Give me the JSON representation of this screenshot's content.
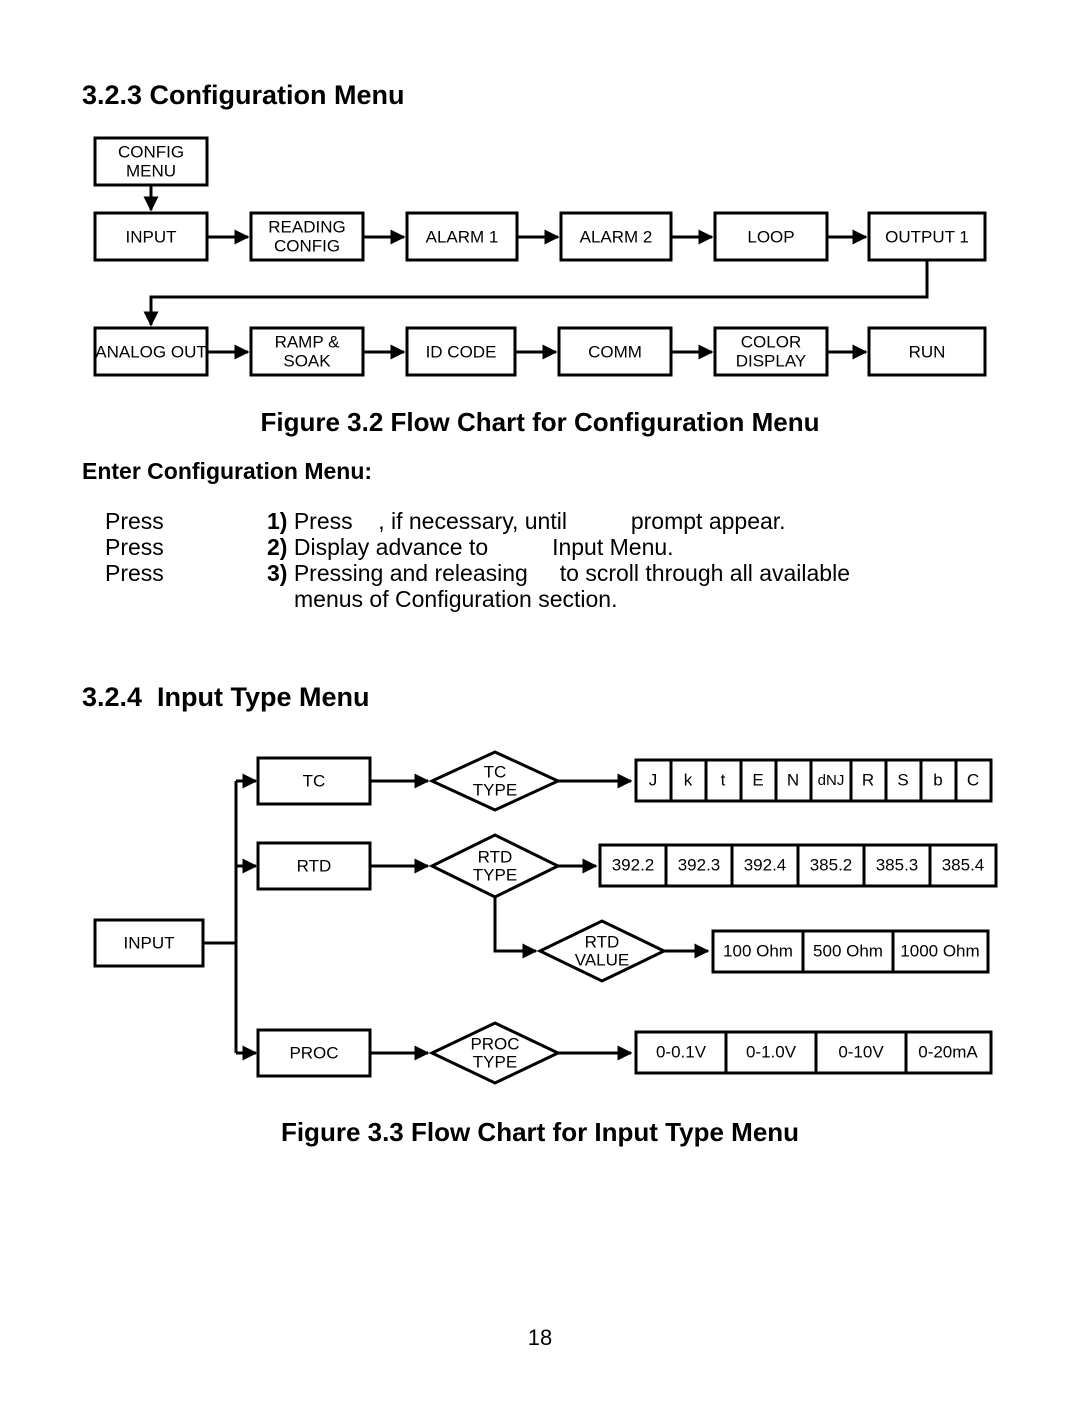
{
  "page": {
    "number": "18"
  },
  "sections": {
    "config_menu": {
      "heading": "3.2.3 Configuration Menu",
      "figure_caption": "Figure 3.2 Flow Chart for Configuration Menu",
      "enter_label": "Enter Configuration Menu:"
    },
    "input_type_menu": {
      "heading": "3.2.4  Input Type Menu",
      "figure_caption": "Figure 3.3 Flow Chart for Input Type Menu"
    }
  },
  "instructions": {
    "press_labels": [
      "Press",
      "Press",
      "Press"
    ],
    "steps": [
      {
        "num": "1)",
        "text": " Press    , if necessary, until          prompt appear."
      },
      {
        "num": "2)",
        "text": " Display advance to          Input Menu."
      },
      {
        "num": "3)",
        "text": " Pressing and releasing     to scroll through all available"
      }
    ],
    "step3_continuation": "menus of Configuration section."
  },
  "chart_data": {
    "config_flow": {
      "type": "diagram",
      "title": "Figure 3.2 Flow Chart for Configuration Menu",
      "entry_node": "CONFIG MENU",
      "row1": [
        "INPUT",
        "READING CONFIG",
        "ALARM 1",
        "ALARM 2",
        "LOOP",
        "OUTPUT 1"
      ],
      "row2": [
        "ANALOG OUT",
        "RAMP & SOAK",
        "ID CODE",
        "COMM",
        "COLOR DISPLAY",
        "RUN"
      ],
      "nodes": [
        {
          "id": "config-menu",
          "lines": [
            "CONFIG",
            "MENU"
          ]
        },
        {
          "id": "input",
          "lines": [
            "INPUT"
          ]
        },
        {
          "id": "reading-config",
          "lines": [
            "READING",
            "CONFIG"
          ]
        },
        {
          "id": "alarm-1",
          "lines": [
            "ALARM 1"
          ]
        },
        {
          "id": "alarm-2",
          "lines": [
            "ALARM 2"
          ]
        },
        {
          "id": "loop",
          "lines": [
            "LOOP"
          ]
        },
        {
          "id": "output-1",
          "lines": [
            "OUTPUT 1"
          ]
        },
        {
          "id": "analog-out",
          "lines": [
            "ANALOG OUT"
          ]
        },
        {
          "id": "ramp-soak",
          "lines": [
            "RAMP &",
            "SOAK"
          ]
        },
        {
          "id": "id-code",
          "lines": [
            "ID CODE"
          ]
        },
        {
          "id": "comm",
          "lines": [
            "COMM"
          ]
        },
        {
          "id": "color-display",
          "lines": [
            "COLOR",
            "DISPLAY"
          ]
        },
        {
          "id": "run",
          "lines": [
            "RUN"
          ]
        }
      ]
    },
    "input_flow": {
      "type": "diagram",
      "title": "Figure 3.3 Flow Chart for Input Type Menu",
      "root": "INPUT",
      "branches": [
        {
          "name": "TC",
          "decision": [
            "TC",
            "TYPE"
          ],
          "options": [
            "J",
            "k",
            "t",
            "E",
            "N",
            "dNJ",
            "R",
            "S",
            "b",
            "C"
          ]
        },
        {
          "name": "RTD",
          "decision": [
            "RTD",
            "TYPE"
          ],
          "options": [
            "392.2",
            "392.3",
            "392.4",
            "385.2",
            "385.3",
            "385.4"
          ],
          "sub_decision": [
            "RTD",
            "VALUE"
          ],
          "sub_options": [
            "100 Ohm",
            "500 Ohm",
            "1000 Ohm"
          ]
        },
        {
          "name": "PROC",
          "decision": [
            "PROC",
            "TYPE"
          ],
          "options": [
            "0-0.1V",
            "0-1.0V",
            "0-10V",
            "0-20mA"
          ]
        }
      ]
    }
  }
}
